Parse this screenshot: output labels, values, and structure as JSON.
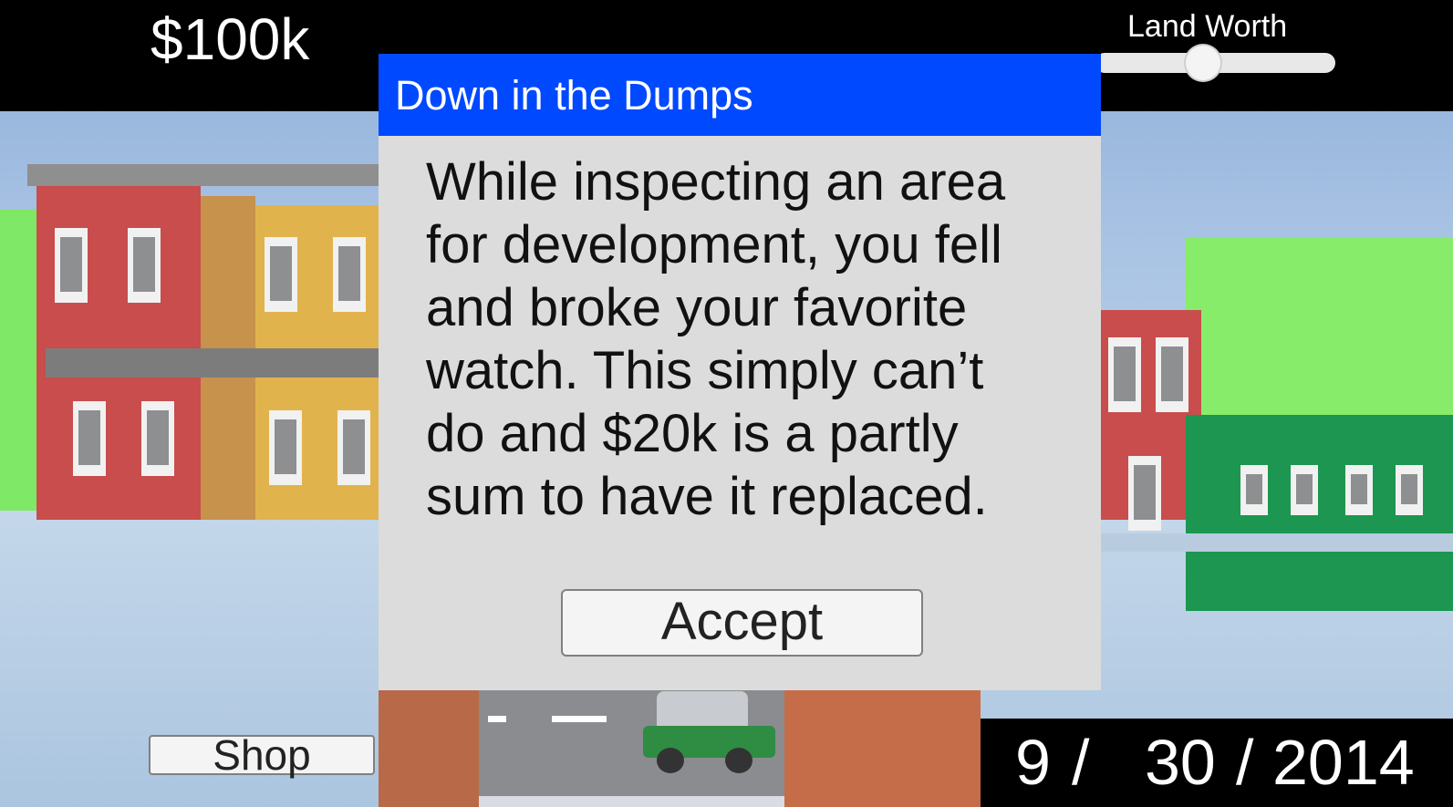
{
  "hud": {
    "money": "$100k",
    "land_worth_label": "Land Worth",
    "land_worth_level": 0.45
  },
  "event_dialog": {
    "title": "Down in the Dumps",
    "lines": [
      "While inspecting an area",
      "for development, you fell",
      "and broke your favorite",
      "watch. This simply can’t",
      "do and $20k is a partly",
      "sum to have it replaced."
    ],
    "accept_label": "Accept"
  },
  "shop_label": "Shop",
  "date": {
    "month": "9",
    "day": "30",
    "year": "2014",
    "sep": "/"
  },
  "colors": {
    "header_blue": "#0049ff",
    "dialog_bg": "#dcdcdc",
    "hud_black": "#000000"
  }
}
